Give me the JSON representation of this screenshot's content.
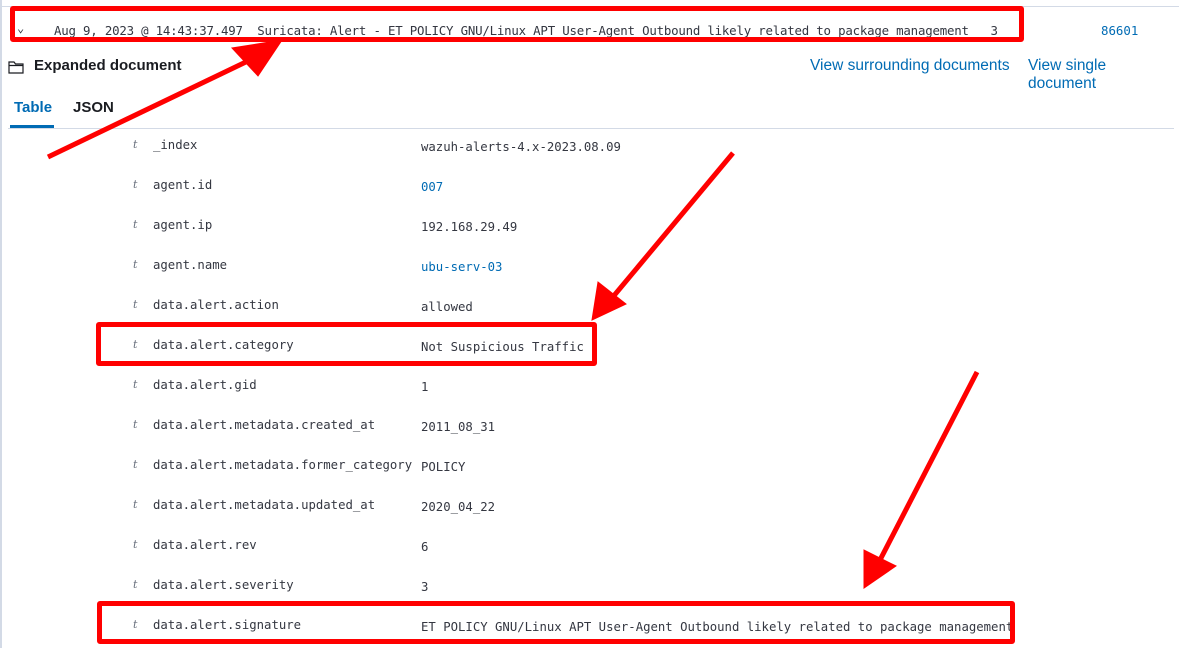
{
  "document_row": {
    "expand_icon": "chevron-down-icon",
    "timestamp": "Aug 9, 2023 @ 14:43:37.497",
    "description": "Suricata: Alert - ET POLICY GNU/Linux APT User-Agent Outbound likely related to package management",
    "level": "3",
    "rule_id": "86601"
  },
  "expanded": {
    "icon": "folder-icon",
    "title": "Expanded document",
    "links": {
      "surrounding": "View surrounding documents",
      "single": "View single document"
    }
  },
  "tabs": [
    {
      "label": "Table",
      "active": true
    },
    {
      "label": "JSON",
      "active": false
    }
  ],
  "fields": [
    {
      "type": "t",
      "name": "_index",
      "value": "wazuh-alerts-4.x-2023.08.09",
      "link": false
    },
    {
      "type": "t",
      "name": "agent.id",
      "value": "007",
      "link": true
    },
    {
      "type": "t",
      "name": "agent.ip",
      "value": "192.168.29.49",
      "link": false
    },
    {
      "type": "t",
      "name": "agent.name",
      "value": "ubu-serv-03",
      "link": true
    },
    {
      "type": "t",
      "name": "data.alert.action",
      "value": "allowed",
      "link": false
    },
    {
      "type": "t",
      "name": "data.alert.category",
      "value": "Not Suspicious Traffic",
      "link": false
    },
    {
      "type": "t",
      "name": "data.alert.gid",
      "value": "1",
      "link": false
    },
    {
      "type": "t",
      "name": "data.alert.metadata.created_at",
      "value": "2011_08_31",
      "link": false
    },
    {
      "type": "t",
      "name": "data.alert.metadata.former_category",
      "value": "POLICY",
      "link": false
    },
    {
      "type": "t",
      "name": "data.alert.metadata.updated_at",
      "value": "2020_04_22",
      "link": false
    },
    {
      "type": "t",
      "name": "data.alert.rev",
      "value": "6",
      "link": false
    },
    {
      "type": "t",
      "name": "data.alert.severity",
      "value": "3",
      "link": false
    },
    {
      "type": "t",
      "name": "data.alert.signature",
      "value": "ET POLICY GNU/Linux APT User-Agent Outbound likely related to package management",
      "link": false
    }
  ],
  "annotations": {
    "color": "#ff0000"
  }
}
